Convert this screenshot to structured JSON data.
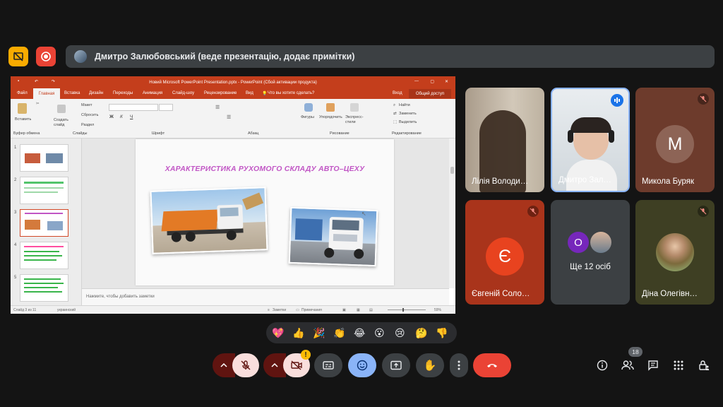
{
  "presenter_bar": {
    "text": "Дмитро Залюбовський (веде презентацію, додає примітки)"
  },
  "powerpoint": {
    "window_title": "Новий Microsoft PowerPoint Presentation.pptx - PowerPoint (Сбой активации продукта)",
    "tabs": [
      "Файл",
      "Главная",
      "Вставка",
      "Дизайн",
      "Переходы",
      "Анимация",
      "Слайд-шоу",
      "Рецензирование",
      "Вид"
    ],
    "search_hint": "Что вы хотите сделать?",
    "sign_in": "Вход",
    "share": "Общий доступ",
    "ribbon": {
      "paste": "Вставить",
      "new_slide": "Создать слайд",
      "layout": "Макет",
      "reset": "Сбросить",
      "section": "Раздел",
      "find": "Найти",
      "replace": "Заменить",
      "select": "Выделить",
      "shapes": "Фигуры",
      "arrange": "Упорядочить",
      "quick_styles": "Экспресс-стили",
      "groups": [
        "Буфер обмена",
        "Слайды",
        "Шрифт",
        "Абзац",
        "Рисование",
        "Редактирование"
      ]
    },
    "slide_numbers": [
      "1",
      "2",
      "3",
      "4",
      "5"
    ],
    "slide_title": "ХАРАКТЕРИСТИКА РУХОМОГО СКЛАДУ АВТО–ЦЕХУ",
    "notes_placeholder": "Нажмите, чтобы добавить заметки",
    "status": {
      "slide_counter": "Слайд 3 из 11",
      "language": "украинский",
      "notes": "Заметки",
      "comments": "Примечания",
      "zoom": "59%"
    }
  },
  "participants": [
    {
      "name": "Лілія Володи…"
    },
    {
      "name": "Дмитро Зал…"
    },
    {
      "name": "Микола Буряк",
      "initial": "М"
    },
    {
      "name": "Євгеній Соло…",
      "initial": "Є"
    },
    {
      "name": "Ще 12 осіб",
      "initial": "О"
    },
    {
      "name": "Діна Олегівн…"
    }
  ],
  "reactions": [
    "💖",
    "👍",
    "🎉",
    "👏",
    "😂",
    "😮",
    "😢",
    "🤔",
    "👎"
  ],
  "controls": {
    "camera_alert": "!",
    "people_count": "18"
  },
  "colors": {
    "background": "#141414",
    "powerpoint_accent": "#c43e1c",
    "end_call": "#ea4335",
    "reaction_active": "#8ab4f8",
    "muted_control": "#f9dedc",
    "muted_control_dark": "#601410"
  }
}
